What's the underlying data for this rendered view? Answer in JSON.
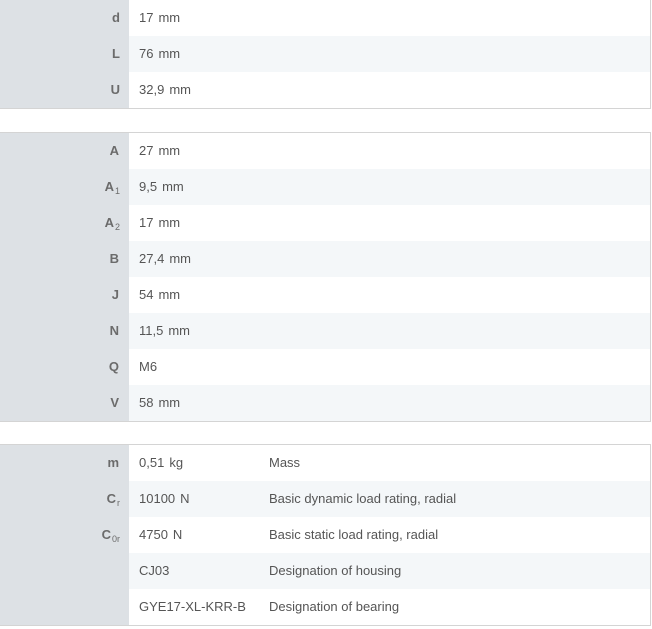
{
  "table1": {
    "rows": [
      {
        "label": "d",
        "value": "17",
        "unit": "mm"
      },
      {
        "label": "L",
        "value": "76",
        "unit": "mm"
      },
      {
        "label": "U",
        "value": "32,9",
        "unit": "mm"
      }
    ]
  },
  "table2": {
    "rows": [
      {
        "label": "A",
        "sub": "",
        "value": "27",
        "unit": "mm"
      },
      {
        "label": "A",
        "sub": "1",
        "value": "9,5",
        "unit": "mm"
      },
      {
        "label": "A",
        "sub": "2",
        "value": "17",
        "unit": "mm"
      },
      {
        "label": "B",
        "sub": "",
        "value": "27,4",
        "unit": "mm"
      },
      {
        "label": "J",
        "sub": "",
        "value": "54",
        "unit": "mm"
      },
      {
        "label": "N",
        "sub": "",
        "value": "11,5",
        "unit": "mm"
      },
      {
        "label": "Q",
        "sub": "",
        "value": "M6",
        "unit": ""
      },
      {
        "label": "V",
        "sub": "",
        "value": "58",
        "unit": "mm"
      }
    ]
  },
  "table3": {
    "rows": [
      {
        "label": "m",
        "sub": "",
        "value": "0,51",
        "unit": "kg",
        "description": "Mass"
      },
      {
        "label": "C",
        "sub": "r",
        "value": "10100",
        "unit": "N",
        "description": "Basic dynamic load rating, radial"
      },
      {
        "label": "C",
        "sub": "0r",
        "value": "4750",
        "unit": "N",
        "description": "Basic static load rating, radial"
      },
      {
        "label": "",
        "sub": "",
        "value": "CJ03",
        "unit": "",
        "description": "Designation of housing"
      },
      {
        "label": "",
        "sub": "",
        "value": "GYE17-XL-KRR-B",
        "unit": "",
        "description": "Designation of bearing"
      }
    ]
  }
}
